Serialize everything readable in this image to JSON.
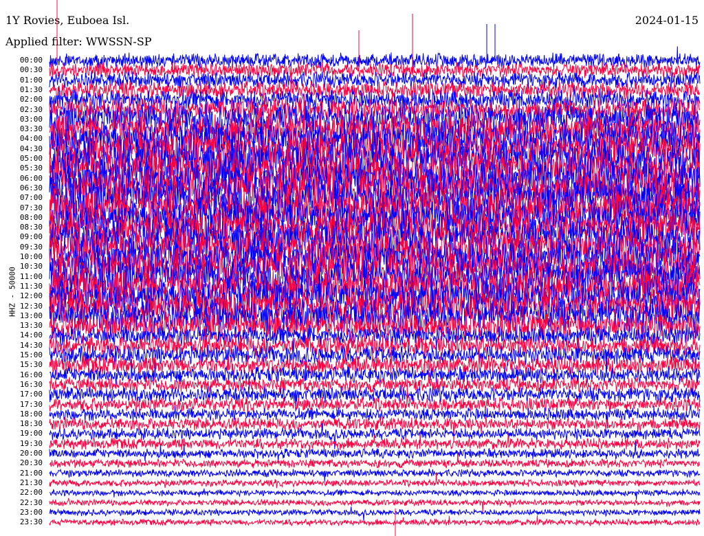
{
  "header": {
    "station": "1Y Rovies, Euboea Isl.",
    "date": "2024-01-15",
    "filter": "Applied filter: WWSSN-SP"
  },
  "chart_data": {
    "type": "helicorder",
    "title": "1Y Rovies, Euboea Isl.",
    "ylabel": "HHZ - 50000",
    "trace_duration_minutes": 30,
    "colors": [
      "#0000ff",
      "#ff0040"
    ],
    "time_labels": [
      "00:00",
      "00:30",
      "01:00",
      "01:30",
      "02:00",
      "02:30",
      "03:00",
      "03:30",
      "04:00",
      "04:30",
      "05:00",
      "05:30",
      "06:00",
      "06:30",
      "07:00",
      "07:30",
      "08:00",
      "08:30",
      "09:00",
      "09:30",
      "10:00",
      "10:30",
      "11:00",
      "11:30",
      "12:00",
      "12:30",
      "13:00",
      "13:30",
      "14:00",
      "14:30",
      "15:00",
      "15:30",
      "16:00",
      "16:30",
      "17:00",
      "17:30",
      "18:00",
      "18:30",
      "19:00",
      "19:30",
      "20:00",
      "20:30",
      "21:00",
      "21:30",
      "22:00",
      "22:30",
      "23:00",
      "23:30"
    ],
    "relative_amplitude": [
      1.2,
      1.2,
      1.3,
      1.4,
      1.6,
      1.8,
      2.5,
      2.8,
      3,
      3,
      3.2,
      3.2,
      3.2,
      3.2,
      3.2,
      3.2,
      3.2,
      3,
      3,
      3,
      3,
      3,
      3,
      3,
      3,
      2.8,
      2.6,
      2.2,
      1.6,
      1.6,
      1.5,
      1.5,
      1.3,
      1.2,
      1.2,
      1.1,
      1.0,
      1.0,
      0.9,
      0.9,
      0.8,
      0.7,
      0.6,
      0.55,
      0.5,
      0.5,
      0.5,
      0.5
    ]
  }
}
